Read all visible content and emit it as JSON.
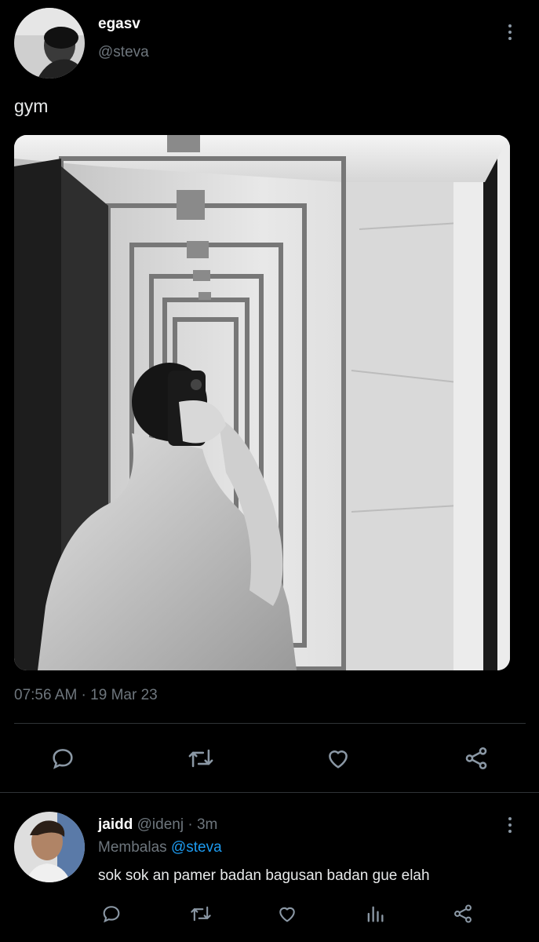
{
  "tweet": {
    "display_name": "egasv",
    "handle": "@steva",
    "text": "gym",
    "timestamp": "07:56 AM · 19 Mar 23",
    "more_icon": "kebab-vertical-icon",
    "media_description_icon": "photo-mirror-selfie"
  },
  "actions": {
    "reply_icon": "reply-icon",
    "retweet_icon": "retweet-icon",
    "like_icon": "heart-icon",
    "share_icon": "share-icon"
  },
  "reply": {
    "display_name": "jaidd",
    "handle": "@idenj",
    "time": "· 3m",
    "replying_prefix": "Membalas",
    "replying_to": "@steva",
    "text": "sok sok an pamer badan bagusan badan gue elah"
  },
  "reply_actions": {
    "reply_icon": "reply-icon",
    "retweet_icon": "retweet-icon",
    "like_icon": "heart-icon",
    "analytics_icon": "analytics-icon",
    "share_icon": "share-icon"
  },
  "colors": {
    "background": "#000000",
    "text": "#e7e9ea",
    "muted": "#6e767d",
    "accent": "#1d9bf0",
    "divider": "#2f3336"
  }
}
